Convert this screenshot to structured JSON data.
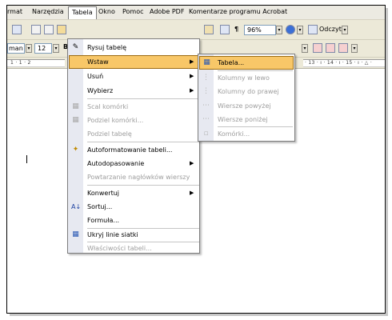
{
  "menubar": {
    "items": [
      "rmat",
      "Narzędzia",
      "Tabela",
      "Okno",
      "Pomoc",
      "Adobe PDF",
      "Komentarze programu Acrobat"
    ]
  },
  "toolbar": {
    "zoom": "96%",
    "read_label": "Odczyt",
    "font_name": "man",
    "font_size": "12"
  },
  "ruler": {
    "left_text": "1 · 1 · 2",
    "right_text": "· 13 · ı · 14 · ı · 15 · ı · △ ·"
  },
  "tabela_menu": {
    "items": [
      {
        "label": "Rysuj tabelę",
        "disabled": false
      },
      {
        "label": "Wstaw",
        "disabled": false,
        "submenu": true
      },
      {
        "label": "Usuń",
        "disabled": false,
        "submenu": true
      },
      {
        "label": "Wybierz",
        "disabled": false,
        "submenu": true
      },
      {
        "label": "Scal komórki",
        "disabled": true
      },
      {
        "label": "Podziel komórki...",
        "disabled": true
      },
      {
        "label": "Podziel tabelę",
        "disabled": true
      },
      {
        "label": "Autoformatowanie tabeli...",
        "disabled": false
      },
      {
        "label": "Autodopasowanie",
        "disabled": false,
        "submenu": true
      },
      {
        "label": "Powtarzanie nagłówków wierszy",
        "disabled": true
      },
      {
        "label": "Konwertuj",
        "disabled": false,
        "submenu": true
      },
      {
        "label": "Sortuj...",
        "disabled": false
      },
      {
        "label": "Formuła...",
        "disabled": false
      },
      {
        "label": "Ukryj linie siatki",
        "disabled": false
      },
      {
        "label": "Właściwości tabeli...",
        "disabled": true
      }
    ]
  },
  "wstaw_submenu": {
    "items": [
      {
        "label": "Tabela...",
        "disabled": false
      },
      {
        "label": "Kolumny w lewo",
        "disabled": true
      },
      {
        "label": "Kolumny do prawej",
        "disabled": true
      },
      {
        "label": "Wiersze powyżej",
        "disabled": true
      },
      {
        "label": "Wiersze poniżej",
        "disabled": true
      },
      {
        "label": "Komórki...",
        "disabled": true
      }
    ]
  },
  "colors": {
    "highlight": "#f8c768",
    "menu_gutter": "#e7e9f1",
    "toolbar": "#ece9d8"
  }
}
